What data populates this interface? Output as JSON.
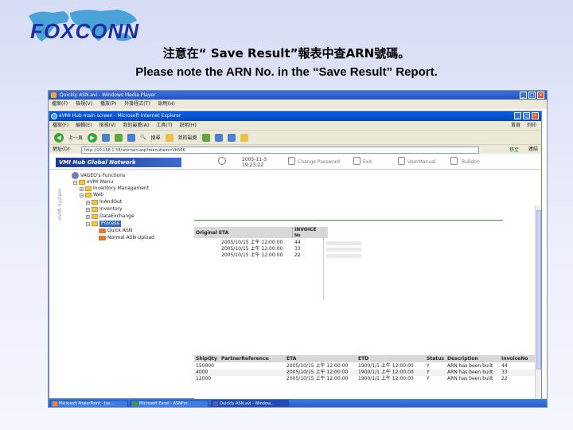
{
  "slide": {
    "logo_text": "FOXCONN",
    "title_cn": "注意在“ Save Result”報表中查ARN號碼。",
    "title_en": "Please note the ARN No. in the “Save Result” Report."
  },
  "wmp": {
    "title": "Quickly ASN.avi - Windows Media Player",
    "menu": [
      "檔案(F)",
      "檢視(V)",
      "播放(P)",
      "外掛程式(T)",
      "說明(H)"
    ]
  },
  "ie": {
    "title": "eVMI Hub main screen - Microsoft Internet Explorer",
    "menu": [
      "檔案(F)",
      "編輯(E)",
      "檢視(V)",
      "我的最愛(A)",
      "工具(T)",
      "說明(H)"
    ],
    "menu_right": [
      "首頁",
      "列印"
    ],
    "toolbar": {
      "back": "上一頁",
      "search": "搜尋",
      "favorites": "我的最愛"
    },
    "address_label": "網址(D)",
    "address": "http://10.168.1.58/vmmain.asp?menuItem=VK666",
    "go": "移至",
    "links": "連結"
  },
  "vmi": {
    "logo": "VMI Hub Global Network",
    "date": "2005-11-3",
    "time": "19:23:22",
    "header_items": [
      "Change Password",
      "Exit",
      "UserManual",
      "Bulletin"
    ],
    "side_label": "eVMI System",
    "tree": {
      "root": "VAGEO's Functions",
      "items": [
        "eVMI Menu",
        "Inventory Management",
        "Web",
        "InAndOut",
        "Inventory",
        "DataExchange",
        "Process",
        "Quick ASN",
        "Normal ASN Upload"
      ]
    }
  },
  "top_grid": {
    "columns": [
      "Original ETA",
      "INVOICE",
      "No"
    ],
    "rows": [
      {
        "eta": "2005/10/15 上午 12:00:00",
        "invoice": "44"
      },
      {
        "eta": "2005/10/15 上午 12:00:00",
        "invoice": "33"
      },
      {
        "eta": "2005/10/15 上午 12:00:00",
        "invoice": "22"
      }
    ]
  },
  "bottom_grid": {
    "columns": [
      "ShipQty",
      "PartnerReference",
      "ETA",
      "ETD",
      "Status",
      "Description",
      "InvoiceNo"
    ],
    "rows": [
      {
        "qty": "150000",
        "eta": "2005/10/15 上午 12:00:00",
        "etd": "1900/1/1 上午 12:00:00",
        "status": "Y",
        "desc": "ARN has been built",
        "inv": "44"
      },
      {
        "qty": "4000",
        "eta": "2005/10/15 上午 12:00:00",
        "etd": "1900/1/1 上午 12:00:00",
        "status": "Y",
        "desc": "ARN has been built",
        "inv": "33"
      },
      {
        "qty": "12000",
        "eta": "2005/10/15 上午 12:00:00",
        "etd": "1900/1/1 上午 12:00:00",
        "status": "Y",
        "desc": "ARN has been built",
        "inv": "22"
      }
    ]
  },
  "taskbar": [
    "Microsoft PowerPoint - [sa...",
    "Microsoft Excel - ASNFor...",
    "Quickly ASN.avi - Window..."
  ]
}
